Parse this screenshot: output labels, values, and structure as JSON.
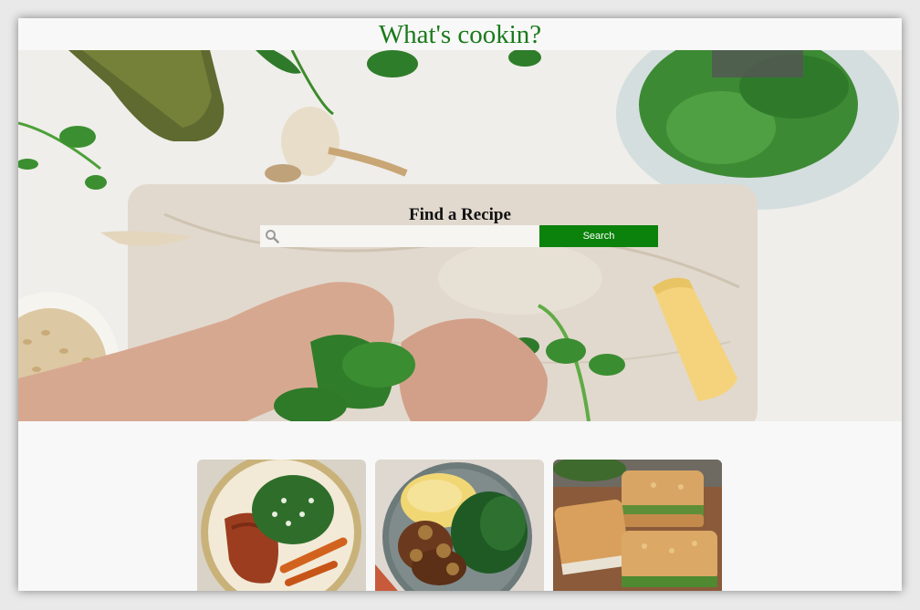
{
  "header": {
    "title": "What's cookin?"
  },
  "hero": {
    "heading": "Find a Recipe",
    "search": {
      "value": "",
      "placeholder": "",
      "icon": "search-icon",
      "button_label": "Search"
    }
  },
  "colors": {
    "brand_green": "#0b820b",
    "title_green": "#1a7a1a"
  },
  "recipe_cards": [
    {
      "image": "chicken-with-greens-and-carrots-photo"
    },
    {
      "image": "salisbury-steak-mashed-potatoes-kale-photo"
    },
    {
      "image": "toasted-sandwiches-photo"
    }
  ]
}
